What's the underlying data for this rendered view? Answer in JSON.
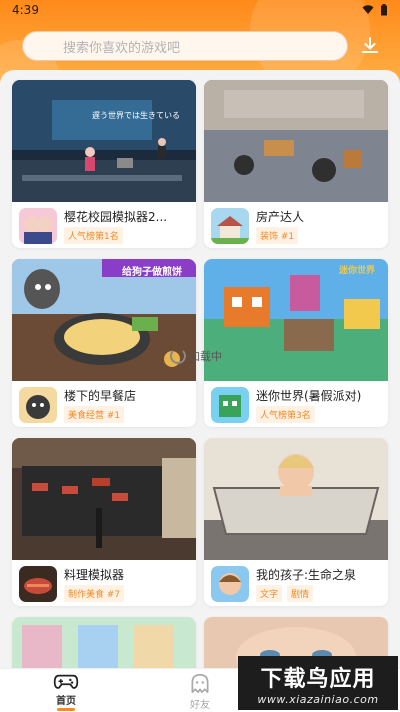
{
  "status": {
    "time": "4:39"
  },
  "search": {
    "placeholder": "搜索你喜欢的游戏吧"
  },
  "overlay": {
    "loading_text": "加载中"
  },
  "games": [
    {
      "title": "樱花校园模拟器2...",
      "tags": [
        "人气榜第1名"
      ],
      "thumb_text": "遅う世界では生きている"
    },
    {
      "title": "房产达人",
      "tags": [
        "装饰 #1"
      ]
    },
    {
      "title": "楼下的早餐店",
      "tags": [
        "美食经营 #1"
      ],
      "thumb_text": "给狗子做煎饼"
    },
    {
      "title": "迷你世界(暑假派对)",
      "tags": [
        "人气榜第3名"
      ],
      "thumb_text": "迷你世界"
    },
    {
      "title": "料理模拟器",
      "tags": [
        "制作美食 #7"
      ]
    },
    {
      "title": "我的孩子:生命之泉",
      "tags": [
        "文字",
        "剧情"
      ]
    }
  ],
  "tabbar": {
    "home_label": "首页",
    "friends_label": "好友"
  },
  "watermark": {
    "main": "下载鸟应用",
    "sub": "www.xiazainiao.com"
  },
  "colors": {
    "accent": "#ff8a1a",
    "tag_text": "#f08a24",
    "tag_bg": "#fff1e3"
  }
}
